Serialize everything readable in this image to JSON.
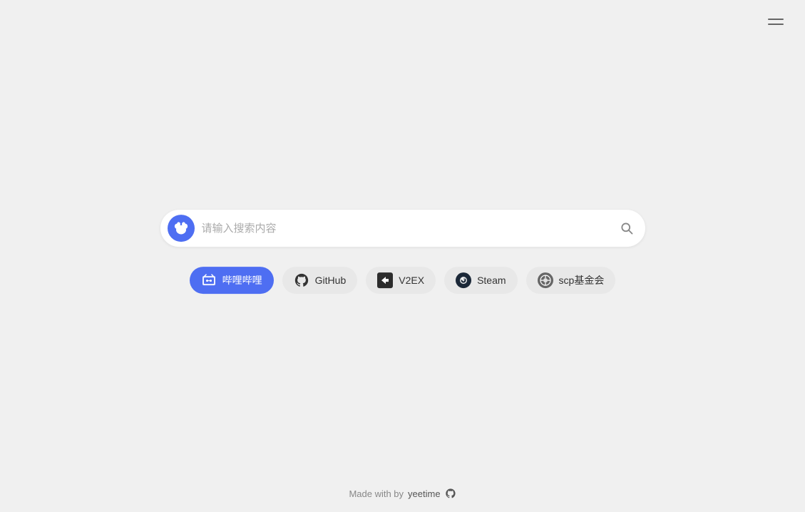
{
  "header": {
    "menu_label": "menu"
  },
  "search": {
    "placeholder": "请输入搜索内容",
    "logo_text": "du"
  },
  "quick_links": [
    {
      "id": "bilibili",
      "label": "哔哩哔哩",
      "icon": "bilibili-icon"
    },
    {
      "id": "github",
      "label": "GitHub",
      "icon": "github-icon"
    },
    {
      "id": "v2ex",
      "label": "V2EX",
      "icon": "v2ex-icon"
    },
    {
      "id": "steam",
      "label": "Steam",
      "icon": "steam-icon"
    },
    {
      "id": "scp",
      "label": "scp基金会",
      "icon": "scp-icon"
    }
  ],
  "footer": {
    "made_with": "Made with by",
    "author": "yeetime"
  }
}
